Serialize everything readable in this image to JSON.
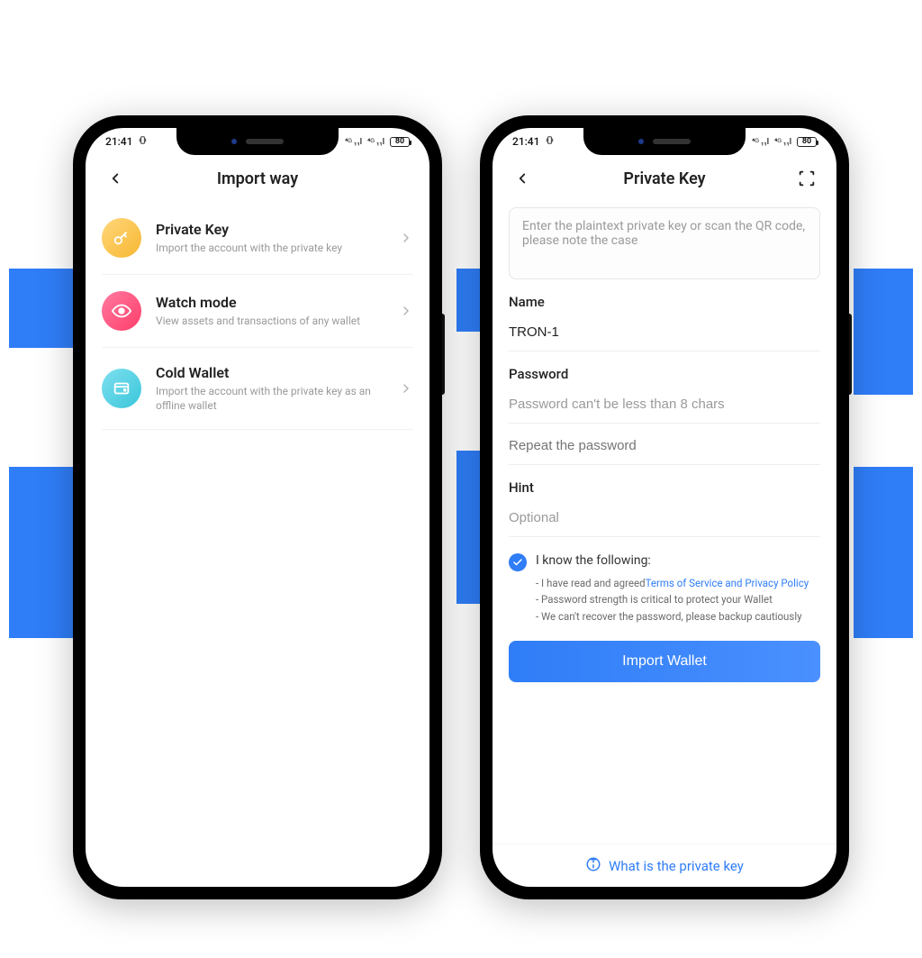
{
  "status": {
    "time": "21:41",
    "battery": "80"
  },
  "phoneA": {
    "appbar": {
      "title": "Import way"
    },
    "options": [
      {
        "title": "Private Key",
        "sub": "Import the account with the private key"
      },
      {
        "title": "Watch mode",
        "sub": "View assets and transactions of any wallet"
      },
      {
        "title": "Cold Wallet",
        "sub": "Import the account with the private key as an offline wallet"
      }
    ]
  },
  "phoneB": {
    "appbar": {
      "title": "Private Key"
    },
    "textarea_placeholder": "Enter the plaintext private key or scan the QR code, please note the case",
    "name_label": "Name",
    "name_value": "TRON-1",
    "password_label": "Password",
    "password_placeholder": "Password can't be less than 8 chars",
    "repeat_placeholder": "Repeat the password",
    "hint_label": "Hint",
    "hint_placeholder": "Optional",
    "ack_title": "I know the following:",
    "ack_line1_prefix": "- I have read and agreed",
    "ack_line1_link": "Terms of Service and Privacy Policy",
    "ack_line2": "- Password strength is critical to protect your Wallet",
    "ack_line3": "- We can't recover the password, please backup cautiously",
    "import_button": "Import Wallet",
    "footer_link": "What is the private key"
  }
}
